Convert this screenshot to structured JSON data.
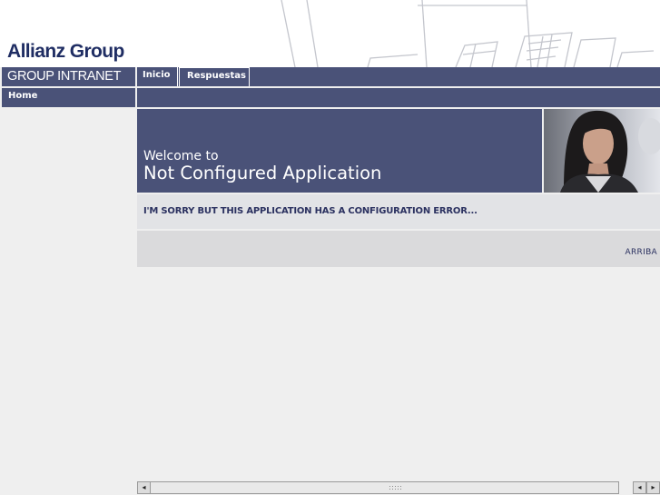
{
  "header": {
    "logo_text": "Allianz Group"
  },
  "sidebar": {
    "title": "GROUP INTRANET",
    "items": [
      {
        "label": "Home"
      }
    ]
  },
  "tabs": [
    {
      "label": "Inicio"
    },
    {
      "label": "Respuestas"
    }
  ],
  "banner": {
    "welcome": "Welcome to",
    "title": "Not Configured Application"
  },
  "message": {
    "text": "I'M SORRY BUT THIS APPLICATION HAS A CONFIGURATION ERROR..."
  },
  "footer": {
    "link_label": "ARRIBA"
  },
  "scrollbar": {
    "left_arrow": "◂",
    "right_arrow": "▸"
  },
  "colors": {
    "nav": "#4a5278",
    "logo": "#1f2d63",
    "message_text": "#2b3160",
    "background": "#efefef"
  }
}
